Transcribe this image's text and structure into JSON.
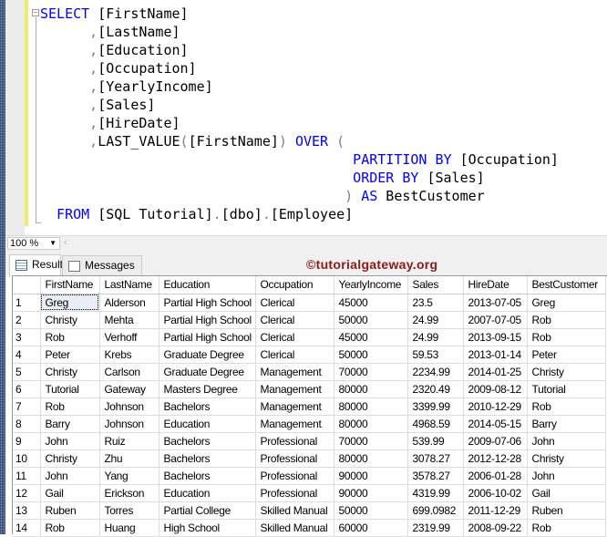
{
  "editor": {
    "lines": [
      [
        {
          "t": "SELECT",
          "c": "kw"
        },
        {
          "t": " [FirstName]",
          "c": "id"
        }
      ],
      [
        {
          "t": "      ,",
          "c": "op"
        },
        {
          "t": "[LastName]",
          "c": "id"
        }
      ],
      [
        {
          "t": "      ,",
          "c": "op"
        },
        {
          "t": "[Education]",
          "c": "id"
        }
      ],
      [
        {
          "t": "      ,",
          "c": "op"
        },
        {
          "t": "[Occupation]",
          "c": "id"
        }
      ],
      [
        {
          "t": "      ,",
          "c": "op"
        },
        {
          "t": "[YearlyIncome]",
          "c": "id"
        }
      ],
      [
        {
          "t": "      ,",
          "c": "op"
        },
        {
          "t": "[Sales]",
          "c": "id"
        }
      ],
      [
        {
          "t": "      ,",
          "c": "op"
        },
        {
          "t": "[HireDate]",
          "c": "id"
        }
      ],
      [
        {
          "t": "      ,",
          "c": "op"
        },
        {
          "t": "LAST_VALUE",
          "c": "id"
        },
        {
          "t": "(",
          "c": "op"
        },
        {
          "t": "[FirstName]",
          "c": "id"
        },
        {
          "t": ")",
          "c": "op"
        },
        {
          "t": " OVER ",
          "c": "kw"
        },
        {
          "t": "(",
          "c": "op"
        }
      ],
      [
        {
          "t": "                                      PARTITION BY",
          "c": "kw"
        },
        {
          "t": " [Occupation]",
          "c": "id"
        }
      ],
      [
        {
          "t": "                                      ORDER BY",
          "c": "kw"
        },
        {
          "t": " [Sales]",
          "c": "id"
        }
      ],
      [
        {
          "t": "                                     )",
          "c": "op"
        },
        {
          "t": " AS",
          "c": "kw"
        },
        {
          "t": " BestCustomer",
          "c": "id"
        }
      ],
      [
        {
          "t": "  FROM",
          "c": "kw"
        },
        {
          "t": " [SQL Tutorial]",
          "c": "id"
        },
        {
          "t": ".",
          "c": "op"
        },
        {
          "t": "[dbo]",
          "c": "id"
        },
        {
          "t": ".",
          "c": "op"
        },
        {
          "t": "[Employee]",
          "c": "id"
        }
      ]
    ]
  },
  "zoom": {
    "value": "100 %"
  },
  "tabs": {
    "results": "Results",
    "messages": "Messages"
  },
  "watermark": "©tutorialgateway.org",
  "grid": {
    "columns": [
      "FirstName",
      "LastName",
      "Education",
      "Occupation",
      "YearlyIncome",
      "Sales",
      "HireDate",
      "BestCustomer"
    ],
    "rows": [
      [
        "1",
        "Greg",
        "Alderson",
        "Partial High School",
        "Clerical",
        "45000",
        "23.5",
        "2013-07-05",
        "Greg"
      ],
      [
        "2",
        "Christy",
        "Mehta",
        "Partial High School",
        "Clerical",
        "50000",
        "24.99",
        "2007-07-05",
        "Rob"
      ],
      [
        "3",
        "Rob",
        "Verhoff",
        "Partial High School",
        "Clerical",
        "45000",
        "24.99",
        "2013-09-15",
        "Rob"
      ],
      [
        "4",
        "Peter",
        "Krebs",
        "Graduate Degree",
        "Clerical",
        "50000",
        "59.53",
        "2013-01-14",
        "Peter"
      ],
      [
        "5",
        "Christy",
        "Carlson",
        "Graduate Degree",
        "Management",
        "70000",
        "2234.99",
        "2014-01-25",
        "Christy"
      ],
      [
        "6",
        "Tutorial",
        "Gateway",
        "Masters Degree",
        "Management",
        "80000",
        "2320.49",
        "2009-08-12",
        "Tutorial"
      ],
      [
        "7",
        "Rob",
        "Johnson",
        "Bachelors",
        "Management",
        "80000",
        "3399.99",
        "2010-12-29",
        "Rob"
      ],
      [
        "8",
        "Barry",
        "Johnson",
        "Education",
        "Management",
        "80000",
        "4968.59",
        "2014-05-15",
        "Barry"
      ],
      [
        "9",
        "John",
        "Ruiz",
        "Bachelors",
        "Professional",
        "70000",
        "539.99",
        "2009-07-06",
        "John"
      ],
      [
        "10",
        "Christy",
        "Zhu",
        "Bachelors",
        "Professional",
        "80000",
        "3078.27",
        "2012-12-28",
        "Christy"
      ],
      [
        "11",
        "John",
        "Yang",
        "Bachelors",
        "Professional",
        "90000",
        "3578.27",
        "2006-01-28",
        "John"
      ],
      [
        "12",
        "Gail",
        "Erickson",
        "Education",
        "Professional",
        "90000",
        "4319.99",
        "2006-10-02",
        "Gail"
      ],
      [
        "13",
        "Ruben",
        "Torres",
        "Partial College",
        "Skilled Manual",
        "50000",
        "699.0982",
        "2011-12-29",
        "Ruben"
      ],
      [
        "14",
        "Rob",
        "Huang",
        "High School",
        "Skilled Manual",
        "60000",
        "2319.99",
        "2008-09-22",
        "Rob"
      ]
    ]
  }
}
